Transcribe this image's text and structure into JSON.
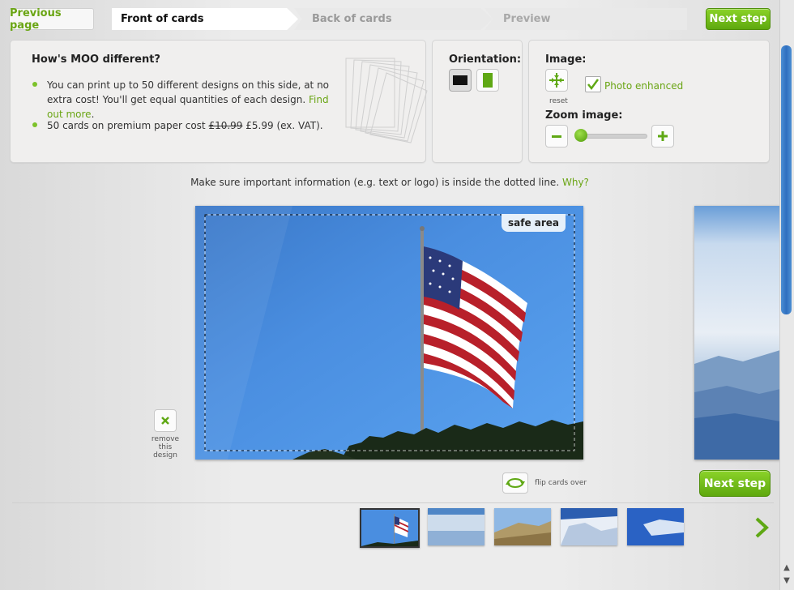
{
  "top_bar": {
    "previous_label": "Previous page",
    "steps": [
      "Front of cards",
      "Back of cards",
      "Preview"
    ],
    "next_label": "Next step"
  },
  "info": {
    "title": "How's MOO different?",
    "bullet1_text": "You can print up to 50 different designs on this side, at no extra cost! You'll get equal quantities of each design.",
    "bullet1_link": "Find out more",
    "bullet1_end": ".",
    "bullet2_prefix": "50 cards on premium paper cost",
    "bullet2_old_price": "£10.99",
    "bullet2_new_price": "£5.99 (ex. VAT)."
  },
  "orientation": {
    "title": "Orientation:",
    "selected": "landscape"
  },
  "image_panel": {
    "title": "Image:",
    "reset_label": "reset",
    "photo_enhanced_label": "Photo enhanced",
    "photo_enhanced_checked": true,
    "zoom_title": "Zoom image:",
    "zoom_level": 0
  },
  "notice": {
    "text": "Make sure important information (e.g. text or logo) is inside the dotted line.",
    "link": "Why?"
  },
  "card": {
    "safe_area_label": "safe area"
  },
  "remove": {
    "label_line1": "remove",
    "label_line2": "this",
    "label_line3": "design"
  },
  "flip_label": "flip cards over",
  "next_bottom_label": "Next step",
  "colors": {
    "accent_green": "#6aa514",
    "button_green": "#5ea80e"
  }
}
